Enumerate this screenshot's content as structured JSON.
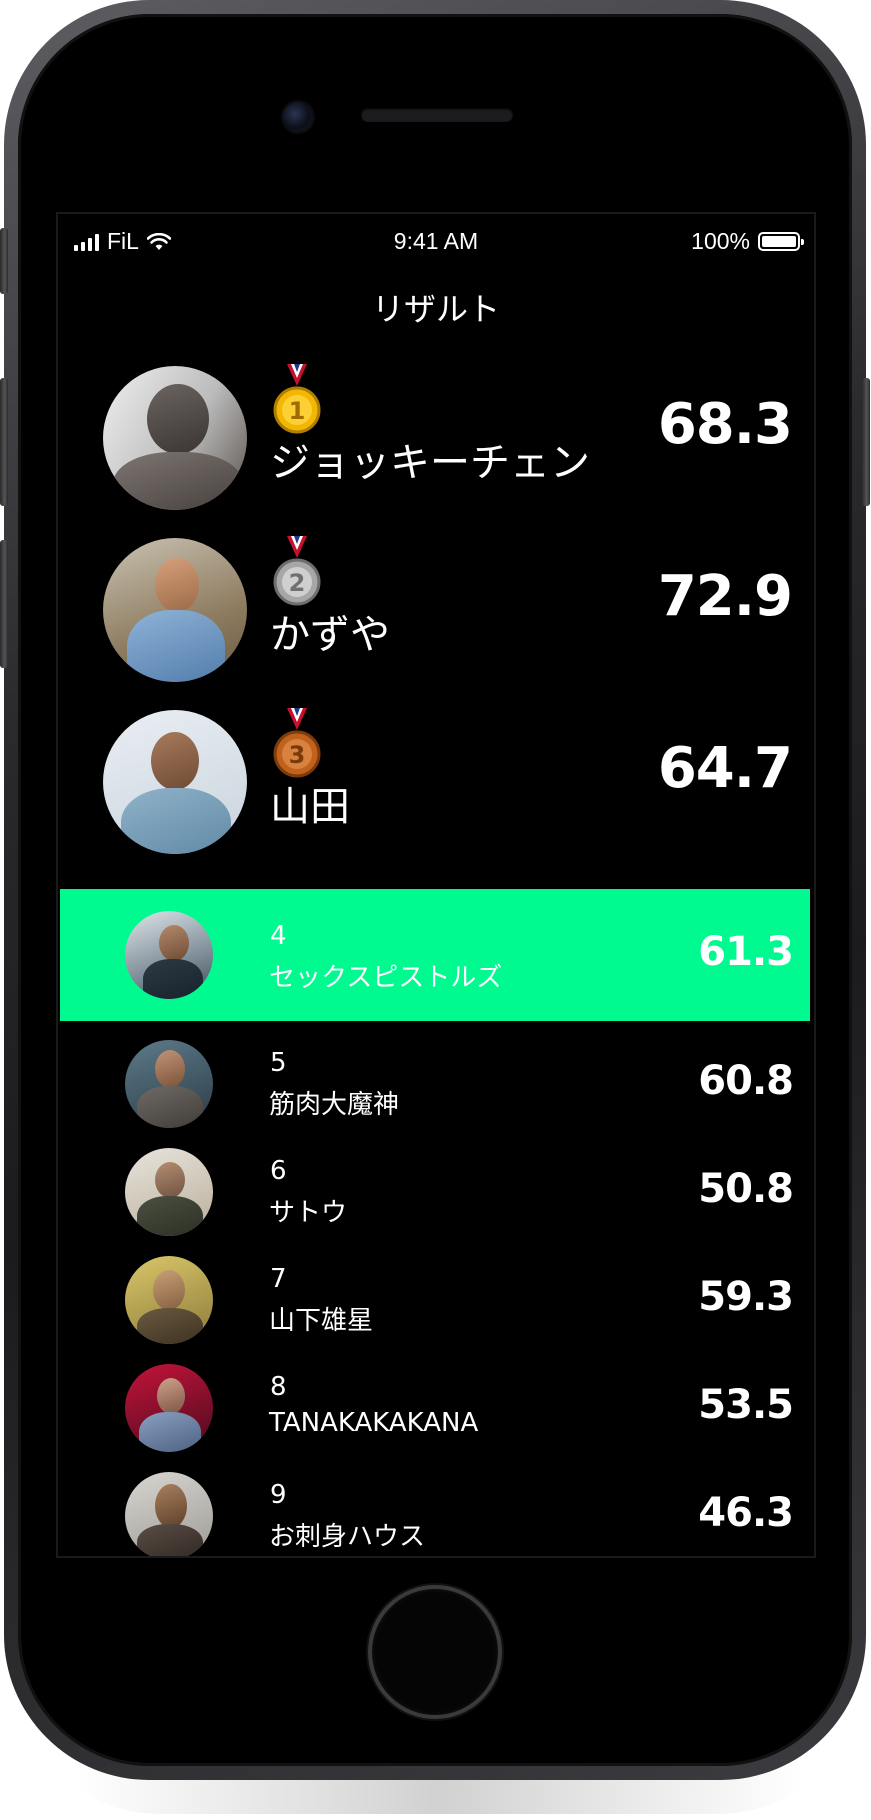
{
  "status_bar": {
    "carrier": "FiL",
    "time": "9:41 AM",
    "battery": "100%"
  },
  "screen_title": "リザルト",
  "podium": [
    {
      "rank": 1,
      "medal": "gold-medal",
      "medal_number": "1",
      "name": "ジョッキーチェン",
      "score": "68.3"
    },
    {
      "rank": 2,
      "medal": "silver-medal",
      "medal_number": "2",
      "name": "かずや",
      "score": "72.9"
    },
    {
      "rank": 3,
      "medal": "bronze-medal",
      "medal_number": "3",
      "name": "山田",
      "score": "64.7"
    }
  ],
  "rankings": [
    {
      "rank": "4",
      "name": "セックスピストルズ",
      "score": "61.3",
      "highlighted": true
    },
    {
      "rank": "5",
      "name": "筋肉大魔神",
      "score": "60.8"
    },
    {
      "rank": "6",
      "name": "サトウ",
      "score": "50.8"
    },
    {
      "rank": "7",
      "name": "山下雄星",
      "score": "59.3"
    },
    {
      "rank": "8",
      "name": "TANAKAKAKANA",
      "score": "53.5"
    },
    {
      "rank": "9",
      "name": "お刺身ハウス",
      "score": "46.3"
    }
  ],
  "colors": {
    "highlight": "#00fa90",
    "background": "#000000",
    "text": "#ffffff",
    "gold": "#f2b705",
    "silver": "#a7a7a7",
    "bronze": "#c0621c"
  }
}
